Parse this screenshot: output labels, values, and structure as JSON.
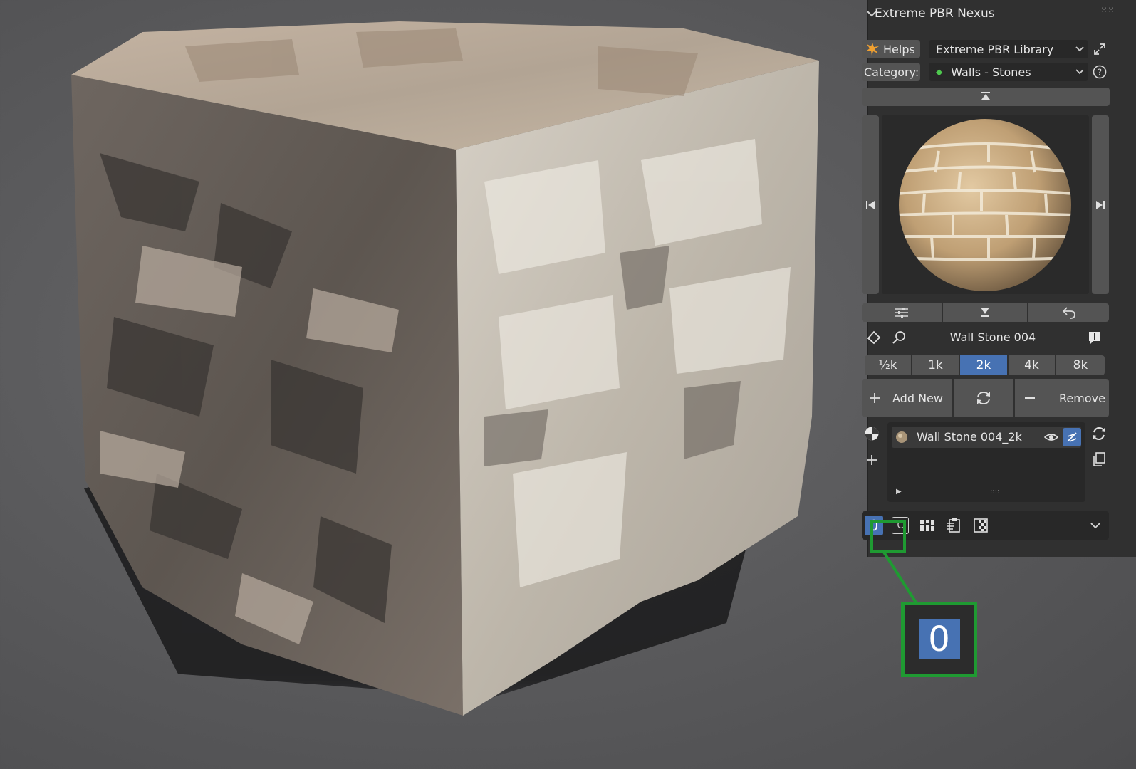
{
  "panel": {
    "title": "Extreme PBR Nexus",
    "helps_label": "Helps",
    "library_value": "Extreme PBR Library",
    "category_label": "Category:",
    "category_value": "Walls - Stones",
    "material_name": "Wall Stone 004",
    "resolutions": [
      "½k",
      "1k",
      "2k",
      "4k",
      "8k"
    ],
    "active_resolution": "2k",
    "add_new_label": "Add New",
    "remove_label": "Remove",
    "slot_name": "Wall Stone 004_2k",
    "grip": "::::",
    "bottom_index": "0",
    "bottom_c": "C"
  },
  "callout": {
    "value": "0"
  },
  "icons": {
    "collapse": "chevron-down-icon",
    "helps": "burst-icon",
    "popout": "popout-icon",
    "help": "question-icon",
    "top": "jump-top-icon",
    "prev": "previous-icon",
    "next": "next-icon",
    "settings": "sliders-icon",
    "download": "download-icon",
    "undo": "undo-icon",
    "shape": "shape-icon",
    "search": "search-icon",
    "info": "info-icon",
    "refresh": "refresh-icon",
    "plus": "plus-icon",
    "minus": "minus-icon",
    "material": "material-ball-icon",
    "eye": "eye-icon",
    "link": "link-icon",
    "copy": "copy-icon"
  },
  "colors": {
    "accent": "#4772b3",
    "panel_bg": "#303030",
    "widget_bg": "#545454",
    "callout_green": "#1f9a32"
  }
}
